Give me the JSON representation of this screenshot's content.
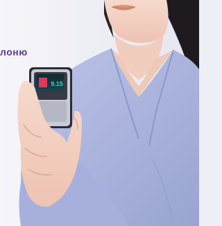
{
  "caption": {
    "text": "лоню"
  },
  "colors": {
    "background": "#eeeef6",
    "caption": "#5a3a8a",
    "blouse": "#aab3df",
    "skin": "#f3d2c4",
    "hair": "#1e1a20",
    "device_body": "#2c2c34",
    "device_screen": "#16303a"
  },
  "device": {
    "screen_readout": "9.15"
  }
}
